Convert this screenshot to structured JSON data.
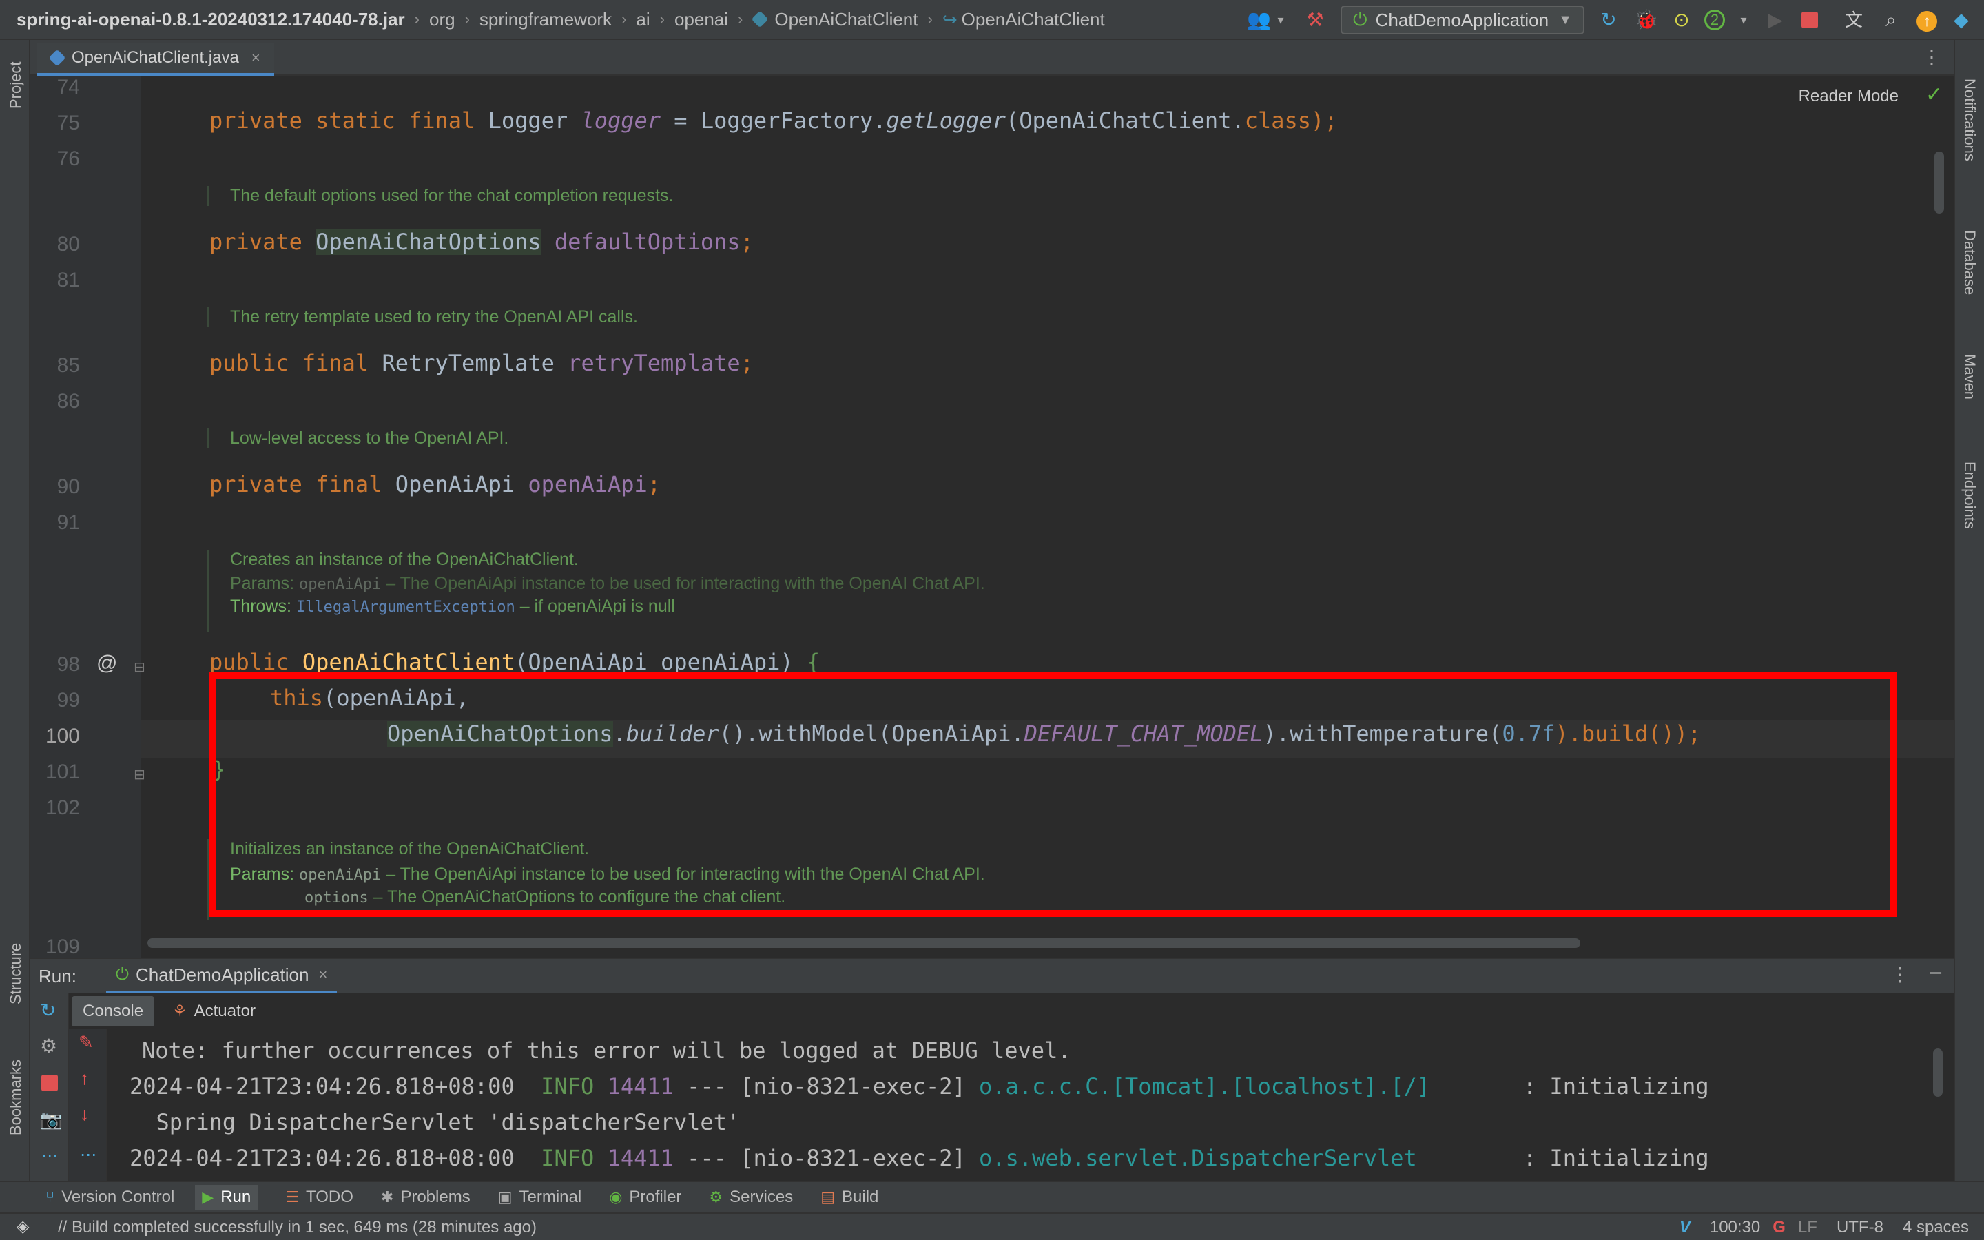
{
  "breadcrumb": {
    "items": [
      "spring-ai-openai-0.8.1-20240312.174040-78.jar",
      "org",
      "springframework",
      "ai",
      "openai",
      "OpenAiChatClient",
      "OpenAiChatClient"
    ]
  },
  "toolbar": {
    "run_config": "ChatDemoApplication",
    "badge_count": "2"
  },
  "tabs": {
    "active": "OpenAiChatClient.java"
  },
  "left_strip": {
    "project": "Project",
    "structure": "Structure",
    "bookmarks": "Bookmarks"
  },
  "right_strip": {
    "notifications": "Notifications",
    "database": "Database",
    "maven": "Maven",
    "endpoints": "Endpoints"
  },
  "editor": {
    "reader_mode": "Reader Mode",
    "line_numbers": [
      "74",
      "75",
      "76",
      "80",
      "81",
      "85",
      "86",
      "90",
      "91",
      "98",
      "99",
      "100",
      "101",
      "102",
      "109"
    ],
    "lines": {
      "l75": {
        "kw": "private static final ",
        "type": "Logger ",
        "field": "logger",
        "eq": " = LoggerFactory.",
        "method": "getLogger",
        "args": "(OpenAiChatClient.",
        "cls": "class",
        "end": ");"
      },
      "l80": {
        "kw": "private ",
        "type": "OpenAiChatOptions",
        "field": "defaultOptions",
        "end": ";"
      },
      "l85": {
        "kw": "public final ",
        "type": "RetryTemplate ",
        "field": "retryTemplate",
        "end": ";"
      },
      "l90": {
        "kw": "private final ",
        "type": "OpenAiApi ",
        "field": "openAiApi",
        "end": ";"
      },
      "l98": {
        "kw": "public ",
        "method": "OpenAiChatClient",
        "args": "(OpenAiApi openAiApi) ",
        "brace": "{"
      },
      "l99": {
        "kw": "this",
        "args": "(openAiApi,"
      },
      "l100": {
        "a": "OpenAiChatOptions",
        "b": ".",
        "c": "builder",
        "d": "().withModel(OpenAiApi.",
        "e": "DEFAULT_CHAT_MODEL",
        "f": ").withTemperature(",
        "g": "0.7f",
        "h": ").build());"
      },
      "l101": {
        "brace": "}"
      }
    },
    "docs": {
      "d1": "The default options used for the chat completion requests.",
      "d2": "The retry template used to retry the OpenAI API calls.",
      "d3": "Low-level access to the OpenAI API.",
      "d4": "Creates an instance of the OpenAiChatClient.",
      "d4_params_label": "Params:",
      "d4_params_name": "openAiApi",
      "d4_params_text": " – The OpenAiApi instance to be used for interacting with the OpenAI Chat API.",
      "d4_throws_label": "Throws:",
      "d4_throws_ref": "IllegalArgumentException",
      "d4_throws_text": " – if openAiApi is null",
      "d5": "Initializes an instance of the OpenAiChatClient.",
      "d5_params_label": "Params:",
      "d5_p1_name": "openAiApi",
      "d5_p1_text": " – The OpenAiApi instance to be used for interacting with the OpenAI Chat API.",
      "d5_p2_name": "options",
      "d5_p2_text": " – The OpenAiChatOptions to configure the chat client."
    }
  },
  "run_panel": {
    "label": "Run:",
    "tab": "ChatDemoApplication",
    "subtabs": [
      "Console",
      "Actuator"
    ],
    "console": [
      {
        "text": "Note: further occurrences of this error will be logged at DEBUG level."
      },
      {
        "ts": "2024-04-21T23:04:26.818+08:00  ",
        "level": "INFO",
        "pid": " 14411",
        "mid": " --- [nio-8321-exec-2] ",
        "logger": "o.a.c.c.C.[Tomcat].[localhost].[/]",
        "msg": "       : Initializing"
      },
      {
        "text": "  Spring DispatcherServlet 'dispatcherServlet'"
      },
      {
        "ts": "2024-04-21T23:04:26.818+08:00  ",
        "level": "INFO",
        "pid": " 14411",
        "mid": " --- [nio-8321-exec-2] ",
        "logger": "o.s.web.servlet.DispatcherServlet",
        "msg": "        : Initializing"
      }
    ]
  },
  "bottom_tools": [
    "Version Control",
    "Run",
    "TODO",
    "Problems",
    "Terminal",
    "Profiler",
    "Services",
    "Build"
  ],
  "status": {
    "message": "// Build completed successfully in 1 sec, 649 ms (28 minutes ago)",
    "position": "100:30",
    "line_sep": "LF",
    "encoding": "UTF-8",
    "indent": "4 spaces"
  },
  "colors": {
    "highlight_box": "#ff0000",
    "accent": "#4a88c7",
    "keyword": "#cc7832",
    "field": "#9876aa",
    "method": "#ffc66d",
    "doc": "#629755"
  }
}
